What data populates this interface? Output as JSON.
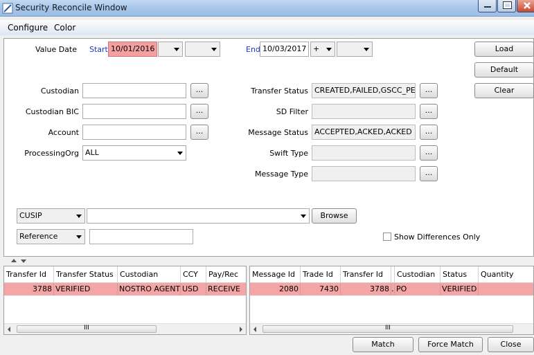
{
  "window": {
    "title": "Security Reconcile Window"
  },
  "menu": {
    "configure": "Configure",
    "color": "Color"
  },
  "value_date": {
    "label": "Value Date",
    "start_label": "Start",
    "start_value": "10/01/2016",
    "end_label": "End",
    "end_value": "10/03/2017",
    "end_offset_sign": "+"
  },
  "left_fields": {
    "custodian": {
      "label": "Custodian",
      "value": ""
    },
    "custodian_bic": {
      "label": "Custodian BIC",
      "value": ""
    },
    "account": {
      "label": "Account",
      "value": ""
    },
    "processing_org": {
      "label": "ProcessingOrg",
      "value": "ALL"
    }
  },
  "right_fields": {
    "transfer_status": {
      "label": "Transfer Status",
      "value": "CREATED,FAILED,GSCC_PENI"
    },
    "sd_filter": {
      "label": "SD Filter",
      "value": ""
    },
    "message_status": {
      "label": "Message Status",
      "value": "ACCEPTED,ACKED,ACKED UNI"
    },
    "swift_type": {
      "label": "Swift Type",
      "value": ""
    },
    "message_type": {
      "label": "Message Type",
      "value": ""
    }
  },
  "ellipsis": "...",
  "side_buttons": {
    "load": "Load",
    "default": "Default",
    "clear": "Clear"
  },
  "security": {
    "type_value": "CUSIP",
    "id_value": "",
    "browse_label": "Browse",
    "reference_type": "Reference",
    "reference_value": ""
  },
  "show_differences": {
    "label": "Show Differences Only",
    "checked": false
  },
  "left_table": {
    "columns": [
      "Transfer Id",
      "Transfer Status",
      "Custodian",
      "CCY",
      "Pay/Rec"
    ],
    "rows": [
      [
        "3788",
        "VERIFIED",
        "NOSTRO AGENT",
        "USD",
        "RECEIVE"
      ]
    ]
  },
  "right_table": {
    "columns": [
      "Message Id",
      "Trade Id",
      "Transfer Id",
      "",
      "Custodian",
      "Status",
      "Quantity"
    ],
    "rows": [
      [
        "2080",
        "7430",
        "3788",
        ".",
        "PO",
        "VERIFIED",
        ""
      ]
    ]
  },
  "scroll_grip": "III",
  "bottom_buttons": {
    "match": "Match",
    "force_match": "Force Match",
    "close": "Close"
  },
  "colors": {
    "highlight_row": "#f4a6a6",
    "start_date_bg": "#f4a0a0",
    "start_label": "#1c37c8"
  }
}
